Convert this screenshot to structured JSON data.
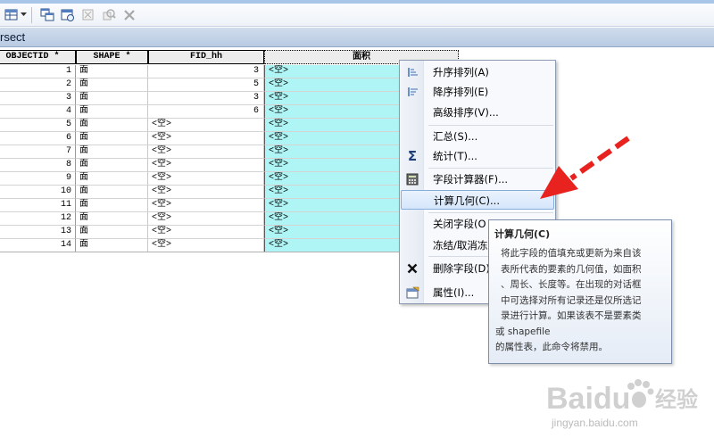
{
  "window": {
    "title": "rsect"
  },
  "toolbar": {
    "icons": [
      "table-options-icon",
      "dropdown-arrow-icon",
      "related-tables-icon",
      "select-by-attributes-icon",
      "clear-selection-icon",
      "zoom-to-selected-icon",
      "delete-selected-icon"
    ]
  },
  "table": {
    "columns": [
      "OBJECTID *",
      "SHAPE *",
      "FID_hh",
      "面积"
    ],
    "rows": [
      {
        "objectid": "1",
        "shape": "面",
        "fid": "3",
        "area": "<空>"
      },
      {
        "objectid": "2",
        "shape": "面",
        "fid": "5",
        "area": "<空>"
      },
      {
        "objectid": "3",
        "shape": "面",
        "fid": "3",
        "area": "<空>"
      },
      {
        "objectid": "4",
        "shape": "面",
        "fid": "6",
        "area": "<空>"
      },
      {
        "objectid": "5",
        "shape": "面",
        "fid": "<空>",
        "area": "<空>"
      },
      {
        "objectid": "6",
        "shape": "面",
        "fid": "<空>",
        "area": "<空>"
      },
      {
        "objectid": "7",
        "shape": "面",
        "fid": "<空>",
        "area": "<空>"
      },
      {
        "objectid": "8",
        "shape": "面",
        "fid": "<空>",
        "area": "<空>"
      },
      {
        "objectid": "9",
        "shape": "面",
        "fid": "<空>",
        "area": "<空>"
      },
      {
        "objectid": "10",
        "shape": "面",
        "fid": "<空>",
        "area": "<空>"
      },
      {
        "objectid": "11",
        "shape": "面",
        "fid": "<空>",
        "area": "<空>"
      },
      {
        "objectid": "12",
        "shape": "面",
        "fid": "<空>",
        "area": "<空>"
      },
      {
        "objectid": "13",
        "shape": "面",
        "fid": "<空>",
        "area": "<空>"
      },
      {
        "objectid": "14",
        "shape": "面",
        "fid": "<空>",
        "area": "<空>"
      }
    ]
  },
  "context_menu": {
    "items": [
      {
        "label": "升序排列(A)",
        "icon": "sort-ascending-icon"
      },
      {
        "label": "降序排列(E)",
        "icon": "sort-descending-icon"
      },
      {
        "label": "高级排序(V)...",
        "icon": ""
      },
      {
        "label": "汇总(S)...",
        "icon": ""
      },
      {
        "label": "统计(T)...",
        "icon": "sigma-icon"
      },
      {
        "label": "字段计算器(F)...",
        "icon": "calculator-icon"
      },
      {
        "label": "计算几何(C)...",
        "icon": ""
      },
      {
        "label": "关闭字段(O",
        "icon": ""
      },
      {
        "label": "冻结/取消冻",
        "icon": ""
      },
      {
        "label": "删除字段(D)",
        "icon": "delete-icon"
      },
      {
        "label": "属性(I)...",
        "icon": "properties-icon"
      }
    ],
    "highlighted": "计算几何(C)..."
  },
  "tooltip": {
    "title": "计算几何(C)",
    "lines": [
      "将此字段的值填充或更新为来自该",
      "表所代表的要素的几何值，如面积",
      "、周长、长度等。在出现的对话框",
      "中可选择对所有记录还是仅所选记",
      "录进行计算。如果该表不是要素类",
      "或 shapefile",
      "的属性表，此命令将禁用。"
    ]
  },
  "watermark": {
    "brand": "Baidu",
    "text": "经验",
    "url": "jingyan.baidu.com"
  },
  "colors": {
    "area_column_bg": "#aff5f5",
    "arrow": "#e8231f",
    "highlight": "#d6e6fb"
  }
}
